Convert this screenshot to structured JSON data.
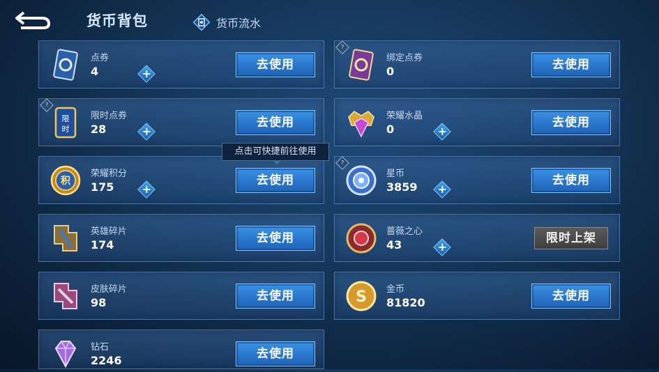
{
  "header": {
    "title": "货币背包",
    "flow_label": "货币流水",
    "back_icon": "back-arrow-icon",
    "flow_icon": "ledger-icon"
  },
  "tooltip": {
    "text": "点击可快捷前往使用"
  },
  "currencies": [
    {
      "name": "点券",
      "amount": "4",
      "button": "去使用",
      "icon": "coupon-card-icon",
      "has_plus": true,
      "bound_mark": false
    },
    {
      "name": "绑定点券",
      "amount": "0",
      "button": "去使用",
      "icon": "bound-coupon-card-icon",
      "has_plus": false,
      "bound_mark": true
    },
    {
      "name": "限时点券",
      "amount": "28",
      "button": "去使用",
      "icon": "limited-coupon-icon",
      "has_plus": true,
      "bound_mark": true
    },
    {
      "name": "荣耀水晶",
      "amount": "0",
      "button": "去使用",
      "icon": "glory-crystal-icon",
      "has_plus": true,
      "bound_mark": false
    },
    {
      "name": "荣耀积分",
      "amount": "175",
      "button": "去使用",
      "icon": "glory-points-icon",
      "has_plus": true,
      "bound_mark": false
    },
    {
      "name": "星币",
      "amount": "3859",
      "button": "去使用",
      "icon": "star-coin-icon",
      "has_plus": true,
      "bound_mark": true
    },
    {
      "name": "英雄碎片",
      "amount": "174",
      "button": "去使用",
      "icon": "hero-fragment-icon",
      "has_plus": false,
      "bound_mark": false
    },
    {
      "name": "蔷薇之心",
      "amount": "43",
      "button": "限时上架",
      "icon": "rose-heart-icon",
      "has_plus": true,
      "bound_mark": false
    },
    {
      "name": "皮肤碎片",
      "amount": "98",
      "button": "去使用",
      "icon": "skin-fragment-icon",
      "has_plus": false,
      "bound_mark": false
    },
    {
      "name": "金币",
      "amount": "81820",
      "button": "去使用",
      "icon": "gold-coin-icon",
      "has_plus": false,
      "bound_mark": false
    },
    {
      "name": "钻石",
      "amount": "2246",
      "button": "去使用",
      "icon": "diamond-icon",
      "has_plus": false,
      "bound_mark": false
    }
  ],
  "colors": {
    "accent_button": "#2a76cc",
    "limited_button": "#4a4a4a",
    "card_border": "#78aae1"
  }
}
